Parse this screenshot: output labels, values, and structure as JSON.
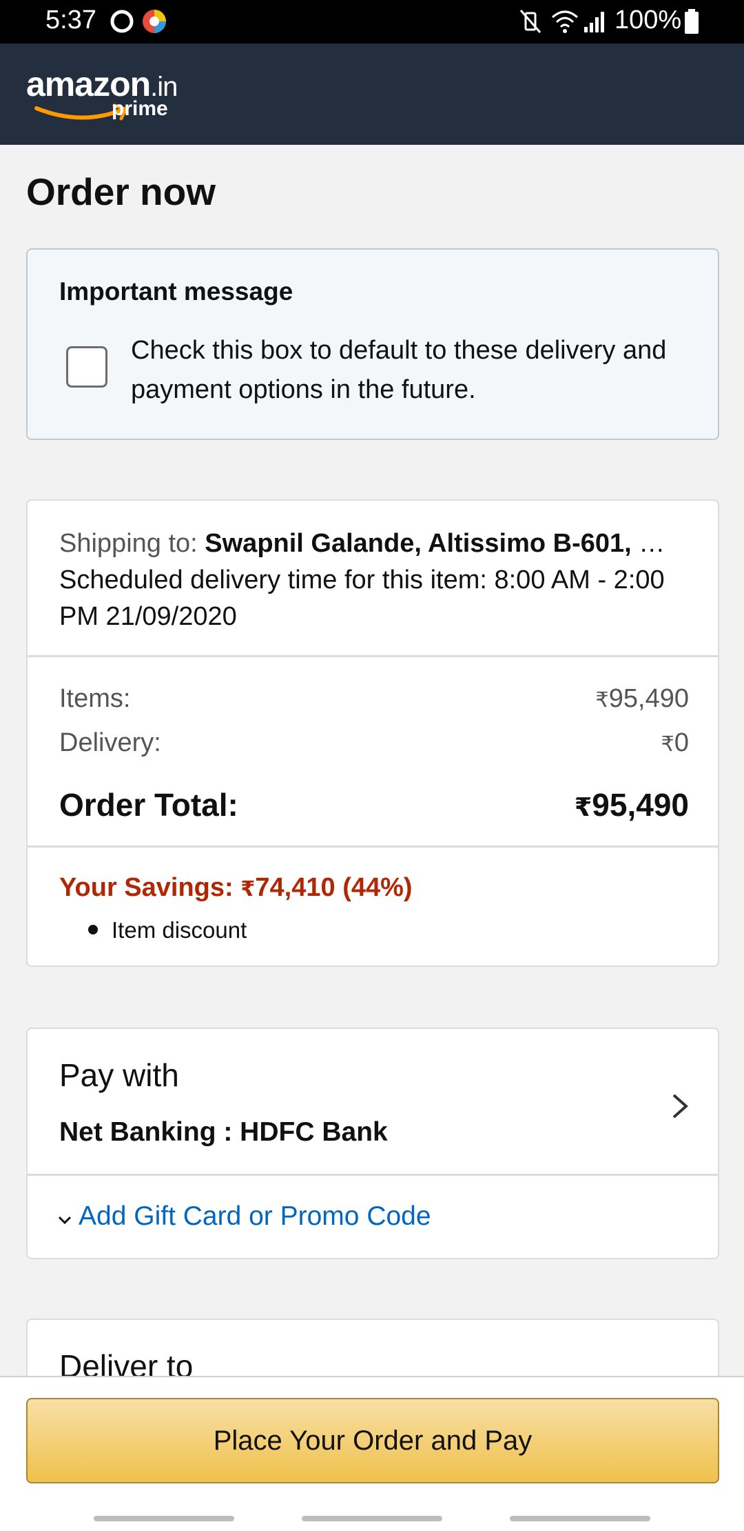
{
  "status_bar": {
    "time": "5:37",
    "battery": "100%"
  },
  "header": {
    "logo_brand": "amazon",
    "logo_domain": ".in",
    "logo_sub": "prime"
  },
  "page_title": "Order now",
  "important": {
    "title": "Important message",
    "checkbox_checked": false,
    "text": "Check this box to default to these delivery and payment options in the future."
  },
  "shipping": {
    "label": "Shipping to:",
    "name": "Swapnil Galande, Altissimo B-601,",
    "schedule": "Scheduled delivery time for this item: 8:00 AM - 2:00 PM 21/09/2020"
  },
  "summary": {
    "currency": "₹",
    "items_label": "Items:",
    "items_value": "95,490",
    "delivery_label": "Delivery:",
    "delivery_value": "0",
    "total_label": "Order Total:",
    "total_value": "95,490"
  },
  "savings": {
    "label": "Your Savings:",
    "amount": "74,410",
    "percent": "(44%)",
    "items": [
      "Item discount"
    ]
  },
  "payment": {
    "title": "Pay with",
    "method": "Net Banking :  HDFC Bank",
    "promo_link": "Add Gift Card or Promo Code"
  },
  "deliver": {
    "title": "Deliver to"
  },
  "cta": {
    "label": "Place Your Order and Pay"
  },
  "colors": {
    "header_bg": "#232f3e",
    "savings_red": "#b12704",
    "link_blue": "#0066c0",
    "button_gold": "#f0c14b"
  }
}
